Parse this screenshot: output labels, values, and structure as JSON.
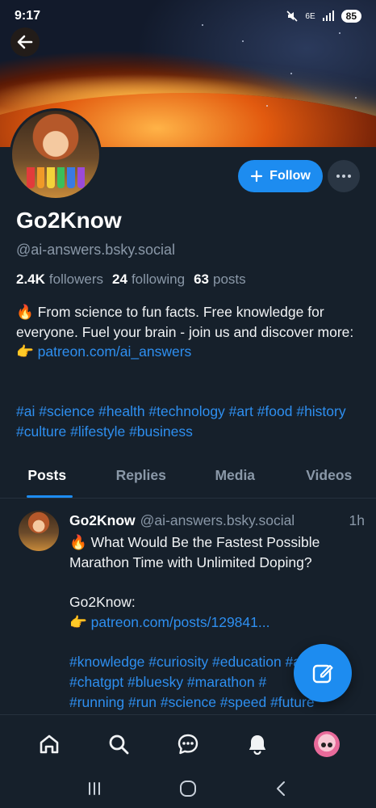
{
  "status_bar": {
    "time": "9:17",
    "network": "6E",
    "battery": "85"
  },
  "profile": {
    "display_name": "Go2Know",
    "handle": "@ai-answers.bsky.social",
    "followers_count": "2.4K",
    "followers_label": "followers",
    "following_count": "24",
    "following_label": "following",
    "posts_count": "63",
    "posts_label": "posts",
    "follow_label": "Follow",
    "bio_line1": "🔥 From science to fun facts. Free knowledge for everyone. Fuel your brain - join us and discover more:",
    "bio_link_prefix": "👉 ",
    "bio_link": "patreon.com/ai_answers",
    "hashtags": "#ai #science #health #technology #art #food #history #culture #lifestyle #business"
  },
  "tabs": [
    {
      "label": "Posts",
      "active": true
    },
    {
      "label": "Replies",
      "active": false
    },
    {
      "label": "Media",
      "active": false
    },
    {
      "label": "Videos",
      "active": false
    }
  ],
  "post": {
    "author": "Go2Know",
    "handle": "@ai-answers.bsky.social",
    "time_ago": "1h",
    "title": "🔥 What Would Be the Fastest Possible Marathon Time with Unlimited Doping?",
    "credit": "Go2Know:",
    "link_prefix": "👉 ",
    "link": "patreon.com/posts/129841...",
    "tags_line1": "#knowledge #curiosity #education #art",
    "tags_line2": "#chatgpt #bluesky #marathon #",
    "tags_line3": "#running #run #science #speed #future"
  },
  "colors": {
    "accent": "#1d8cf0",
    "background": "#16202b",
    "link": "#2e8ff0",
    "muted": "#8a98a8"
  },
  "icons": {
    "back": "arrow-left-icon",
    "more": "ellipsis-icon",
    "compose": "compose-icon",
    "nav": [
      "home-icon",
      "search-icon",
      "chat-icon",
      "bell-icon",
      "profile-avatar"
    ],
    "system": [
      "recent-apps-icon",
      "home-circle-icon",
      "back-chevron-icon"
    ]
  }
}
